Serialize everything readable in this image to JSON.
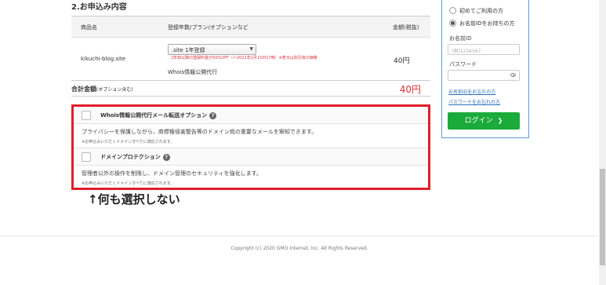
{
  "section_title": "2.お申込み内容",
  "table": {
    "headers": [
      "商品名",
      "登録年数/プラン/オプションなど",
      "金額(税抜)"
    ],
    "row": {
      "domain": "kikuchi-blog.site",
      "plan_select": ".site 1年登録",
      "campaign_note": "2年目以降の登録料金が50%OFF（～2021年1月15日17時）※表示は割引後の価格",
      "whois": "Whois情報公開代行",
      "price": "40円"
    }
  },
  "total": {
    "label": "合計金額",
    "label_suffix": "(オプション含む)",
    "price": "40円"
  },
  "options": [
    {
      "title": "Whois情報公開代行メール転送オプション",
      "description": "プライバシーを保護しながら、商標権侵害警告等のドメイン宛の重要なメールを察知できます。",
      "note": "※お申込みいただくドメインすべてに適応されます。",
      "checked": false
    },
    {
      "title": "ドメインプロテクション",
      "description": "管理者以外の操作を制限し、ドメイン管理のセキュリティを強化します。",
      "note": "※お申込みいただくドメインすべてに適応されます。",
      "checked": false
    }
  ],
  "annotation": "↑何も選択しない",
  "login": {
    "radio_new": "初めてご利用の方",
    "radio_existing": "お名前IDをお持ちの方",
    "id_label": "お名前ID",
    "id_placeholder": "(例)1234567",
    "password_label": "パスワード",
    "forgot_id": "お名前IDをお忘れの方",
    "forgot_password": "パスワードをお忘れの方",
    "login_button": "ログイン"
  },
  "footer": "Copyright (c) 2020 GMO Internet, Inc. All Rights Reserved.",
  "colors": {
    "highlight_border": "#e01f2a",
    "price_red": "#d9343e",
    "login_green": "#1aab3a",
    "link_blue": "#2a6ebb"
  }
}
